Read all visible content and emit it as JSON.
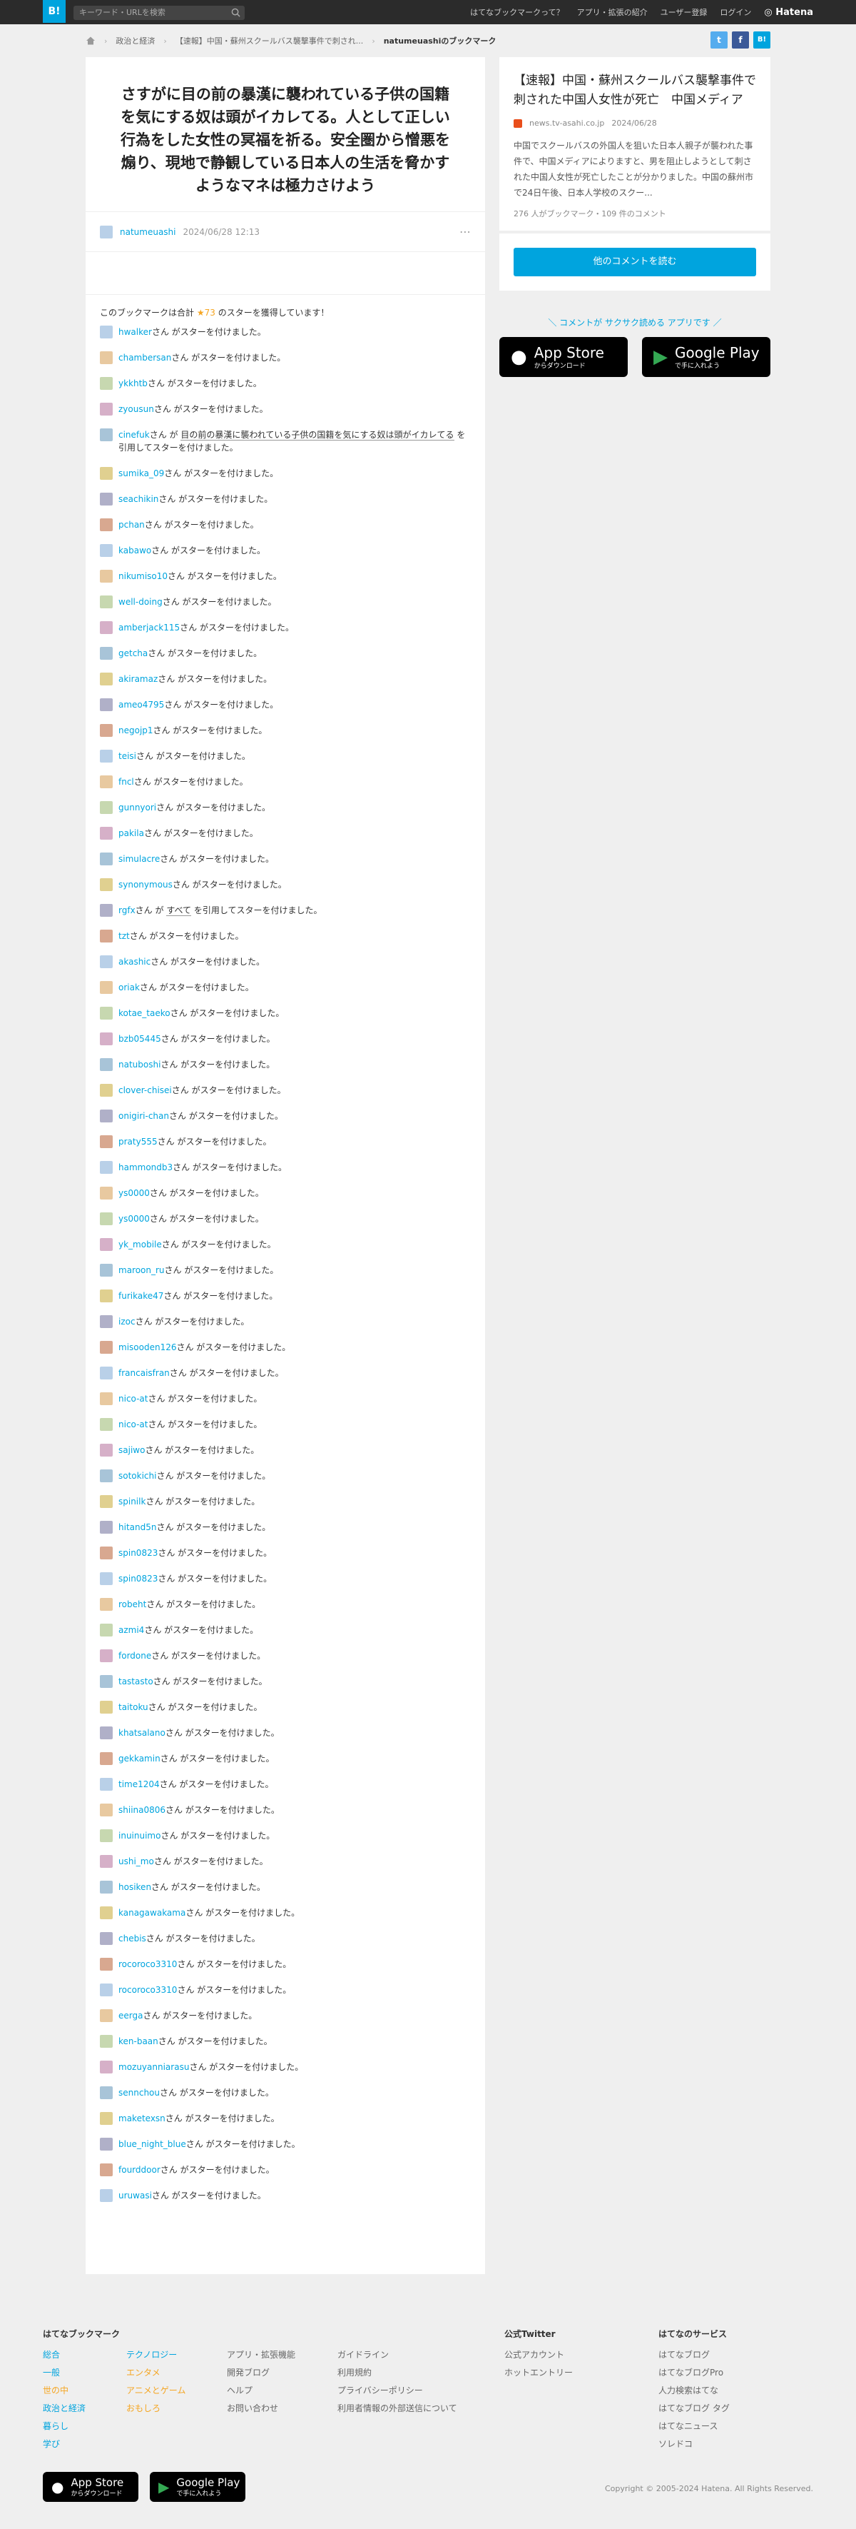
{
  "topbar": {
    "logo": "B!",
    "search_placeholder": "キーワード・URLを検索",
    "nav": [
      "はてなブックマークって？",
      "アプリ・拡張の紹介",
      "ユーザー登録",
      "ログイン"
    ],
    "brand": "◎ Hatena"
  },
  "breadcrumb": {
    "items": [
      "政治と経済",
      "【速報】中国・蘇州スクールバス襲撃事件で刺され...",
      "natumeuashiのブックマーク"
    ]
  },
  "social": {
    "twitter": "t",
    "facebook": "f",
    "hatena": "B!"
  },
  "entry": {
    "title": "さすがに目の前の暴漢に襲われている子供の国籍を気にする奴は頭がイカレてる。人として正しい行為をした女性の冥福を祈る。安全圏から憎悪を煽り、現地で静観している日本人の生活を脅かすようなマネは極力さけよう",
    "user": "natumeuashi",
    "date": "2024/06/28 12:13",
    "more": "⋯"
  },
  "stars": {
    "total_prefix": "このブックマークは合計",
    "total_value": "★73",
    "total_suffix": "のスターを獲得しています！",
    "default_text": "さんがスターを付けました。",
    "items": [
      {
        "user": "hwalker",
        "text": "さん がスターを付けました。"
      },
      {
        "user": "chambersan",
        "text": "さん がスターを付けました。"
      },
      {
        "user": "ykkhtb",
        "text": "さん がスターを付けました。"
      },
      {
        "user": "zyousun",
        "text": "さん がスターを付けました。"
      },
      {
        "user": "cinefuk",
        "text": "さん が",
        "quote": "目の前の暴漢に襲われている子供の国籍を気にする奴は頭がイカレてる",
        "after": "を引用してスターを付けました。"
      },
      {
        "user": "sumika_09",
        "text": "さん がスターを付けました。"
      },
      {
        "user": "seachikin",
        "text": "さん がスターを付けました。"
      },
      {
        "user": "pchan",
        "text": "さん がスターを付けました。"
      },
      {
        "user": "kabawo",
        "text": "さん がスターを付けました。"
      },
      {
        "user": "nikumiso10",
        "text": "さん がスターを付けました。"
      },
      {
        "user": "well-doing",
        "text": "さん がスターを付けました。"
      },
      {
        "user": "amberjack115",
        "text": "さん がスターを付けました。"
      },
      {
        "user": "getcha",
        "text": "さん がスターを付けました。"
      },
      {
        "user": "akiramaz",
        "text": "さん がスターを付けました。"
      },
      {
        "user": "ameo4795",
        "text": "さん がスターを付けました。"
      },
      {
        "user": "negojp1",
        "text": "さん がスターを付けました。"
      },
      {
        "user": "teisi",
        "text": "さん がスターを付けました。"
      },
      {
        "user": "fncl",
        "text": "さん がスターを付けました。"
      },
      {
        "user": "gunnyori",
        "text": "さん がスターを付けました。"
      },
      {
        "user": "pakila",
        "text": "さん がスターを付けました。"
      },
      {
        "user": "simulacre",
        "text": "さん がスターを付けました。"
      },
      {
        "user": "synonymous",
        "text": "さん がスターを付けました。"
      },
      {
        "user": "rgfx",
        "text": "さん が",
        "quote": "すべて",
        "after": "を引用してスターを付けました。"
      },
      {
        "user": "tzt",
        "text": "さん がスターを付けました。"
      },
      {
        "user": "akashic",
        "text": "さん がスターを付けました。"
      },
      {
        "user": "oriak",
        "text": "さん がスターを付けました。"
      },
      {
        "user": "kotae_taeko",
        "text": "さん がスターを付けました。"
      },
      {
        "user": "bzb05445",
        "text": "さん がスターを付けました。"
      },
      {
        "user": "natuboshi",
        "text": "さん がスターを付けました。"
      },
      {
        "user": "clover-chisei",
        "text": "さん がスターを付けました。"
      },
      {
        "user": "onigiri-chan",
        "text": "さん がスターを付けました。"
      },
      {
        "user": "praty555",
        "text": "さん がスターを付けました。"
      },
      {
        "user": "hammondb3",
        "text": "さん がスターを付けました。"
      },
      {
        "user": "ys0000",
        "text": "さん がスターを付けました。"
      },
      {
        "user": "ys0000",
        "text": "さん がスターを付けました。"
      },
      {
        "user": "yk_mobile",
        "text": "さん がスターを付けました。"
      },
      {
        "user": "maroon_ru",
        "text": "さん がスターを付けました。"
      },
      {
        "user": "furikake47",
        "text": "さん がスターを付けました。"
      },
      {
        "user": "izoc",
        "text": "さん がスターを付けました。"
      },
      {
        "user": "misooden126",
        "text": "さん がスターを付けました。"
      },
      {
        "user": "francaisfran",
        "text": "さん がスターを付けました。"
      },
      {
        "user": "nico-at",
        "text": "さん がスターを付けました。"
      },
      {
        "user": "nico-at",
        "text": "さん がスターを付けました。"
      },
      {
        "user": "sajiwo",
        "text": "さん がスターを付けました。"
      },
      {
        "user": "sotokichi",
        "text": "さん がスターを付けました。"
      },
      {
        "user": "spinilk",
        "text": "さん がスターを付けました。"
      },
      {
        "user": "hitand5n",
        "text": "さん がスターを付けました。"
      },
      {
        "user": "spin0823",
        "text": "さん がスターを付けました。"
      },
      {
        "user": "spin0823",
        "text": "さん がスターを付けました。"
      },
      {
        "user": "robeht",
        "text": "さん がスターを付けました。"
      },
      {
        "user": "azmi4",
        "text": "さん がスターを付けました。"
      },
      {
        "user": "fordone",
        "text": "さん がスターを付けました。"
      },
      {
        "user": "tastasto",
        "text": "さん がスターを付けました。"
      },
      {
        "user": "taitoku",
        "text": "さん がスターを付けました。"
      },
      {
        "user": "khatsalano",
        "text": "さん がスターを付けました。"
      },
      {
        "user": "gekkamin",
        "text": "さん がスターを付けました。"
      },
      {
        "user": "time1204",
        "text": "さん がスターを付けました。"
      },
      {
        "user": "shiina0806",
        "text": "さん がスターを付けました。"
      },
      {
        "user": "inuinuimo",
        "text": "さん がスターを付けました。"
      },
      {
        "user": "ushi_mo",
        "text": "さん がスターを付けました。"
      },
      {
        "user": "hosiken",
        "text": "さん がスターを付けました。"
      },
      {
        "user": "kanagawakama",
        "text": "さん がスターを付けました。"
      },
      {
        "user": "chebis",
        "text": "さん がスターを付けました。"
      },
      {
        "user": "rocoroco3310",
        "text": "さん がスターを付けました。"
      },
      {
        "user": "rocoroco3310",
        "text": "さん がスターを付けました。"
      },
      {
        "user": "eerga",
        "text": "さん がスターを付けました。"
      },
      {
        "user": "ken-baan",
        "text": "さん がスターを付けました。"
      },
      {
        "user": "mozuyanniarasu",
        "text": "さん がスターを付けました。"
      },
      {
        "user": "sennchou",
        "text": "さん がスターを付けました。"
      },
      {
        "user": "maketexsn",
        "text": "さん がスターを付けました。"
      },
      {
        "user": "blue_night_blue",
        "text": "さん がスターを付けました。"
      },
      {
        "user": "fourddoor",
        "text": "さん がスターを付けました。"
      },
      {
        "user": "uruwasi",
        "text": "さん がスターを付けました。"
      }
    ]
  },
  "sidebar": {
    "entry_title": "【速報】中国・蘇州スクールバス襲撃事件で刺された中国人女性が死亡　中国メディア",
    "domain": "news.tv-asahi.co.jp",
    "date": "2024/06/28",
    "description": "中国でスクールバスの外国人を狙いた日本人親子が襲われた事件で、中国メディアによりますと、男を阻止しようとして刺された中国人女性が死亡したことが分かりました。中国の蘇州市で24日午後、日本人学校のスクー...",
    "count": "276 人がブックマーク・109 件のコメント",
    "others_button": "他のコメントを読む",
    "app_callout": "＼ コメントが サクサク読める アプリです ／",
    "appstore_big": "App Store",
    "appstore_small": "からダウンロード",
    "googleplay_big": "Google Play",
    "googleplay_small": "で手に入れよう"
  },
  "footer": {
    "col1_title": "はてなブックマーク",
    "col1a": [
      "総合",
      "一般",
      "世の中",
      "政治と経済",
      "暮らし",
      "学び"
    ],
    "col1b": [
      "テクノロジー",
      "エンタメ",
      "アニメとゲーム",
      "おもしろ"
    ],
    "col2": [
      "アプリ・拡張機能",
      "開発ブログ",
      "ヘルプ",
      "お問い合わせ"
    ],
    "col3": [
      "ガイドライン",
      "利用規約",
      "プライバシーポリシー",
      "利用者情報の外部送信について"
    ],
    "col4_title": "公式Twitter",
    "col4": [
      "公式アカウント",
      "ホットエントリー"
    ],
    "col5_title": "はてなのサービス",
    "col5": [
      "はてなブログ",
      "はてなブログPro",
      "人力検索はてな",
      "はてなブログ タグ",
      "はてなニュース",
      "ソレドコ"
    ],
    "copyright": "Copyright © 2005-2024 Hatena. All Rights Reserved."
  },
  "colors": {
    "accent": "#00a4de",
    "star": "#f5a623",
    "topbar": "#2b2b2b"
  }
}
